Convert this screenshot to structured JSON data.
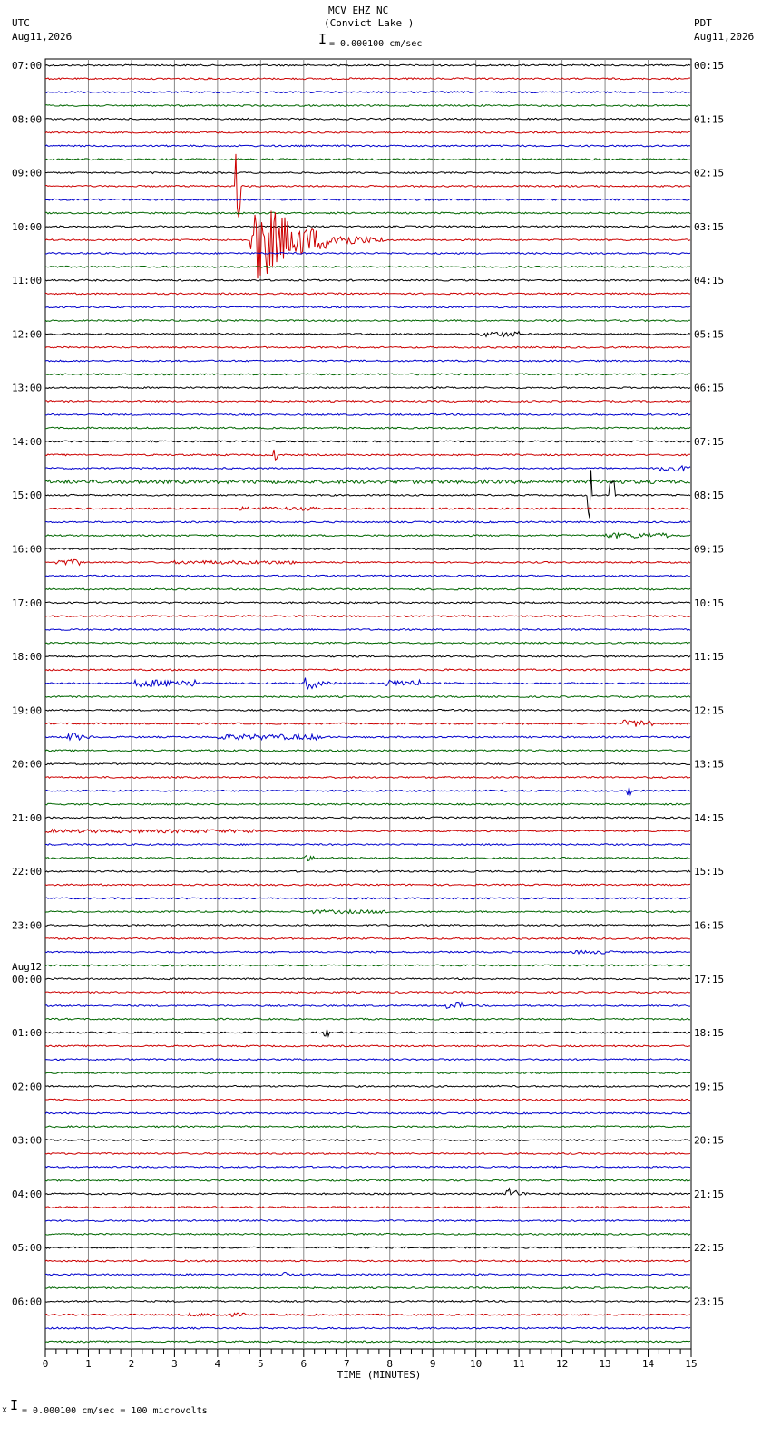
{
  "header": {
    "station": "MCV EHZ NC",
    "location": "(Convict Lake )",
    "scale": "= 0.000100 cm/sec",
    "left_tz": "UTC",
    "left_date": "Aug11,2026",
    "right_tz": "PDT",
    "right_date": "Aug11,2026"
  },
  "footer": {
    "scale_note": "= 0.000100 cm/sec =     100 microvolts"
  },
  "chart_data": {
    "type": "line",
    "title": "MCV EHZ NC (Convict Lake )",
    "xlabel": "TIME (MINUTES)",
    "xlim": [
      0,
      15
    ],
    "x_ticks": [
      "0",
      "1",
      "2",
      "3",
      "4",
      "5",
      "6",
      "7",
      "8",
      "9",
      "10",
      "11",
      "12",
      "13",
      "14",
      "15"
    ],
    "trace_minutes": 15,
    "trace_count": 96,
    "trace_colors": [
      "#000000",
      "#cc0000",
      "#0000cc",
      "#006600"
    ],
    "date_change": {
      "trace": 68,
      "label": "Aug12"
    },
    "left_labels": [
      "07:00",
      "08:00",
      "09:00",
      "10:00",
      "11:00",
      "12:00",
      "13:00",
      "14:00",
      "15:00",
      "16:00",
      "17:00",
      "18:00",
      "19:00",
      "20:00",
      "21:00",
      "22:00",
      "23:00",
      "00:00",
      "01:00",
      "02:00",
      "03:00",
      "04:00",
      "05:00",
      "06:00"
    ],
    "right_labels": [
      "00:15",
      "01:15",
      "02:15",
      "03:15",
      "04:15",
      "05:15",
      "06:15",
      "07:15",
      "08:15",
      "09:15",
      "10:15",
      "11:15",
      "12:15",
      "13:15",
      "14:15",
      "15:15",
      "16:15",
      "17:15",
      "18:15",
      "19:15",
      "20:15",
      "21:15",
      "22:15",
      "23:15"
    ],
    "events": [
      {
        "trace": 9,
        "start_min": 4.4,
        "dur_min": 0.15,
        "amp": 38,
        "style": "spike"
      },
      {
        "trace": 13,
        "start_min": 4.75,
        "dur_min": 3.2,
        "amp": 58,
        "style": "quake"
      },
      {
        "trace": 20,
        "start_min": 10.1,
        "dur_min": 0.9,
        "amp": 3,
        "style": "burst"
      },
      {
        "trace": 29,
        "start_min": 5.3,
        "dur_min": 0.1,
        "amp": 6,
        "style": "spike"
      },
      {
        "trace": 30,
        "start_min": 14.2,
        "dur_min": 0.8,
        "amp": 3,
        "style": "burst"
      },
      {
        "trace": 31,
        "start_min": 0.0,
        "dur_min": 15.0,
        "amp": 2,
        "style": "burst"
      },
      {
        "trace": 32,
        "start_min": 12.6,
        "dur_min": 0.1,
        "amp": 28,
        "style": "spike"
      },
      {
        "trace": 32,
        "start_min": 13.1,
        "dur_min": 0.12,
        "amp": 18,
        "style": "spike"
      },
      {
        "trace": 33,
        "start_min": 4.5,
        "dur_min": 1.8,
        "amp": 2,
        "style": "burst"
      },
      {
        "trace": 35,
        "start_min": 13.0,
        "dur_min": 1.5,
        "amp": 3,
        "style": "burst"
      },
      {
        "trace": 37,
        "start_min": 0.2,
        "dur_min": 0.7,
        "amp": 3,
        "style": "burst"
      },
      {
        "trace": 37,
        "start_min": 3.0,
        "dur_min": 2.8,
        "amp": 2,
        "style": "burst"
      },
      {
        "trace": 46,
        "start_min": 2.0,
        "dur_min": 1.5,
        "amp": 4,
        "style": "burst"
      },
      {
        "trace": 46,
        "start_min": 6.0,
        "dur_min": 1.1,
        "amp": 10,
        "style": "quake"
      },
      {
        "trace": 46,
        "start_min": 7.9,
        "dur_min": 0.8,
        "amp": 4,
        "style": "burst"
      },
      {
        "trace": 49,
        "start_min": 13.4,
        "dur_min": 0.7,
        "amp": 4,
        "style": "burst"
      },
      {
        "trace": 50,
        "start_min": 0.5,
        "dur_min": 1.2,
        "amp": 7,
        "style": "quake"
      },
      {
        "trace": 50,
        "start_min": 4.0,
        "dur_min": 2.5,
        "amp": 3,
        "style": "burst"
      },
      {
        "trace": 54,
        "start_min": 13.5,
        "dur_min": 0.1,
        "amp": 6,
        "style": "spike"
      },
      {
        "trace": 57,
        "start_min": 0.0,
        "dur_min": 5.1,
        "amp": 2,
        "style": "burst"
      },
      {
        "trace": 59,
        "start_min": 6.0,
        "dur_min": 0.7,
        "amp": 6,
        "style": "quake"
      },
      {
        "trace": 63,
        "start_min": 6.0,
        "dur_min": 2.0,
        "amp": 2,
        "style": "burst"
      },
      {
        "trace": 66,
        "start_min": 12.2,
        "dur_min": 1.0,
        "amp": 2,
        "style": "burst"
      },
      {
        "trace": 70,
        "start_min": 9.3,
        "dur_min": 0.4,
        "amp": 4,
        "style": "burst"
      },
      {
        "trace": 72,
        "start_min": 6.45,
        "dur_min": 0.15,
        "amp": 4,
        "style": "spike"
      },
      {
        "trace": 84,
        "start_min": 10.7,
        "dur_min": 0.8,
        "amp": 10,
        "style": "quake"
      },
      {
        "trace": 90,
        "start_min": 5.5,
        "dur_min": 0.5,
        "amp": 5,
        "style": "quake"
      },
      {
        "trace": 93,
        "start_min": 3.2,
        "dur_min": 1.5,
        "amp": 2,
        "style": "burst"
      }
    ]
  }
}
